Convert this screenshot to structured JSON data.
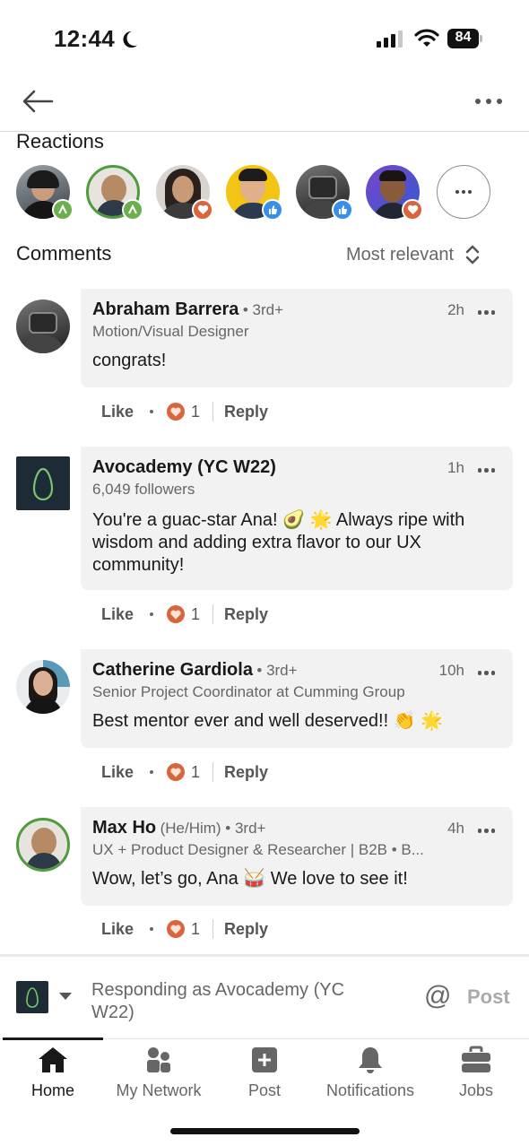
{
  "status_bar": {
    "time": "12:44",
    "battery": "84"
  },
  "reactions": {
    "title": "Reactions",
    "avatars": [
      {
        "reaction": "support-icon"
      },
      {
        "reaction": "support-icon"
      },
      {
        "reaction": "love-icon"
      },
      {
        "reaction": "like-icon"
      },
      {
        "reaction": "like-icon"
      },
      {
        "reaction": "love-icon"
      }
    ]
  },
  "comments": {
    "title": "Comments",
    "sort_label": "Most relevant",
    "items": [
      {
        "name": "Abraham Barrera",
        "meta": "• 3rd+",
        "headline": "Motion/Visual Designer",
        "time": "2h",
        "text": "congrats!",
        "like_label": "Like",
        "reaction_count": "1",
        "reply_label": "Reply"
      },
      {
        "name": "Avocademy (YC W22)",
        "meta": "",
        "headline": "6,049 followers",
        "time": "1h",
        "text": "You're a guac-star Ana! 🥑 🌟 Always ripe with wisdom and adding extra flavor to our UX community!",
        "like_label": "Like",
        "reaction_count": "1",
        "reply_label": "Reply"
      },
      {
        "name": "Catherine Gardiola",
        "meta": "• 3rd+",
        "headline": "Senior Project Coordinator at Cumming Group",
        "time": "10h",
        "text": "Best mentor ever and well deserved!! 👏 🌟",
        "like_label": "Like",
        "reaction_count": "1",
        "reply_label": "Reply"
      },
      {
        "name": "Max Ho",
        "meta": "(He/Him) • 3rd+",
        "headline": "UX + Product Designer & Researcher | B2B • B...",
        "time": "4h",
        "text": "Wow, let’s go, Ana 🥁 We love to see it!",
        "like_label": "Like",
        "reaction_count": "1",
        "reply_label": "Reply"
      }
    ]
  },
  "composer": {
    "responding_as": "Responding as Avocademy (YC W22)",
    "at_symbol": "@",
    "post_label": "Post"
  },
  "bottom_nav": {
    "items": [
      {
        "label": "Home",
        "icon": "home-icon"
      },
      {
        "label": "My Network",
        "icon": "network-icon"
      },
      {
        "label": "Post",
        "icon": "post-icon"
      },
      {
        "label": "Notifications",
        "icon": "bell-icon"
      },
      {
        "label": "Jobs",
        "icon": "briefcase-icon"
      }
    ]
  },
  "colors": {
    "love": "#d9653b",
    "like": "#378fe9",
    "support": "#6dae4f",
    "text": "#191919",
    "muted": "#666666",
    "bubble": "#f2f2f2"
  }
}
